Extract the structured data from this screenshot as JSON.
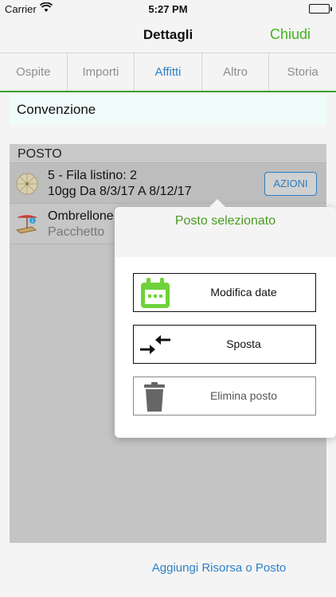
{
  "status_bar": {
    "carrier": "Carrier",
    "time": "5:27 PM"
  },
  "nav": {
    "title": "Dettagli",
    "close_label": "Chiudi"
  },
  "tabs": [
    {
      "label": "Ospite"
    },
    {
      "label": "Importi"
    },
    {
      "label": "Affitti",
      "active": true
    },
    {
      "label": "Altro"
    },
    {
      "label": "Storia"
    }
  ],
  "convention": {
    "label": "Convenzione"
  },
  "posto": {
    "header": "POSTO",
    "rows": [
      {
        "line1": "5 - Fila listino: 2",
        "line2": "10gg  Da 8/3/17 A 8/12/17",
        "icon": "umbrella-icon",
        "action_label": "AZIONI"
      },
      {
        "line1": "Ombrellone",
        "line2": "Pacchetto",
        "icon": "beach-bed-icon"
      }
    ]
  },
  "popover": {
    "title": "Posto selezionato",
    "buttons": [
      {
        "label": "Modifica date",
        "icon": "calendar-icon"
      },
      {
        "label": "Sposta",
        "icon": "move-arrows-icon"
      },
      {
        "label": "Elimina posto",
        "icon": "trash-icon"
      }
    ]
  },
  "footer": {
    "add_label": "Aggiungi Risorsa o Posto"
  },
  "colors": {
    "accent_green": "#3fb51c",
    "accent_blue": "#2f80c8",
    "calendar_green": "#6fd23a"
  }
}
